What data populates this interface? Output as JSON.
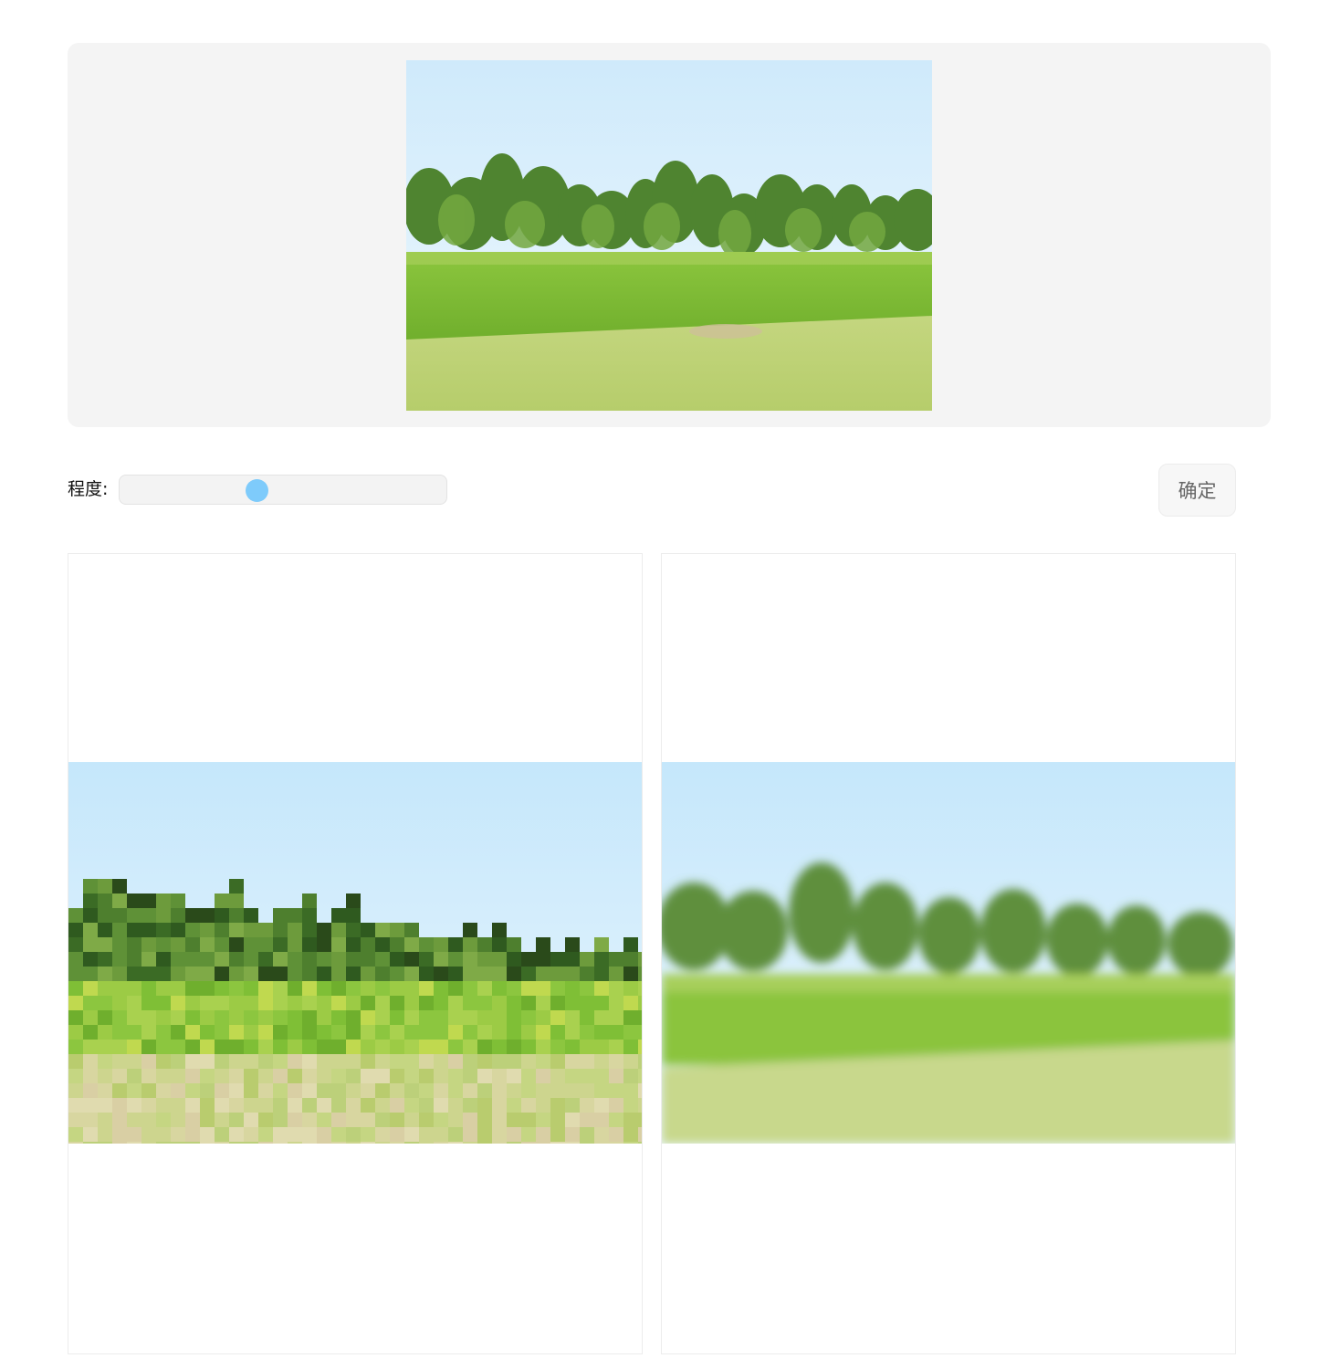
{
  "preview": {
    "image": "landscape-photo-trees-grass-field"
  },
  "controls": {
    "level_label": "程度:",
    "slider": {
      "value_fraction": 0.42
    },
    "confirm_label": "确定"
  },
  "results": [
    {
      "image": "pixelated-mosaic-landscape"
    },
    {
      "image": "blurred-mosaic-landscape"
    }
  ],
  "colors": {
    "slider_thumb": "#7ecbfb",
    "panel_bg": "#f4f4f4",
    "sky_top": "#c5e7fb",
    "sky_bottom": "#eaf6fd",
    "tree_dark": "#3e6f2a",
    "tree_mid": "#5e9537",
    "grass_bright": "#8dc63f",
    "field_light": "#c9d88a"
  }
}
